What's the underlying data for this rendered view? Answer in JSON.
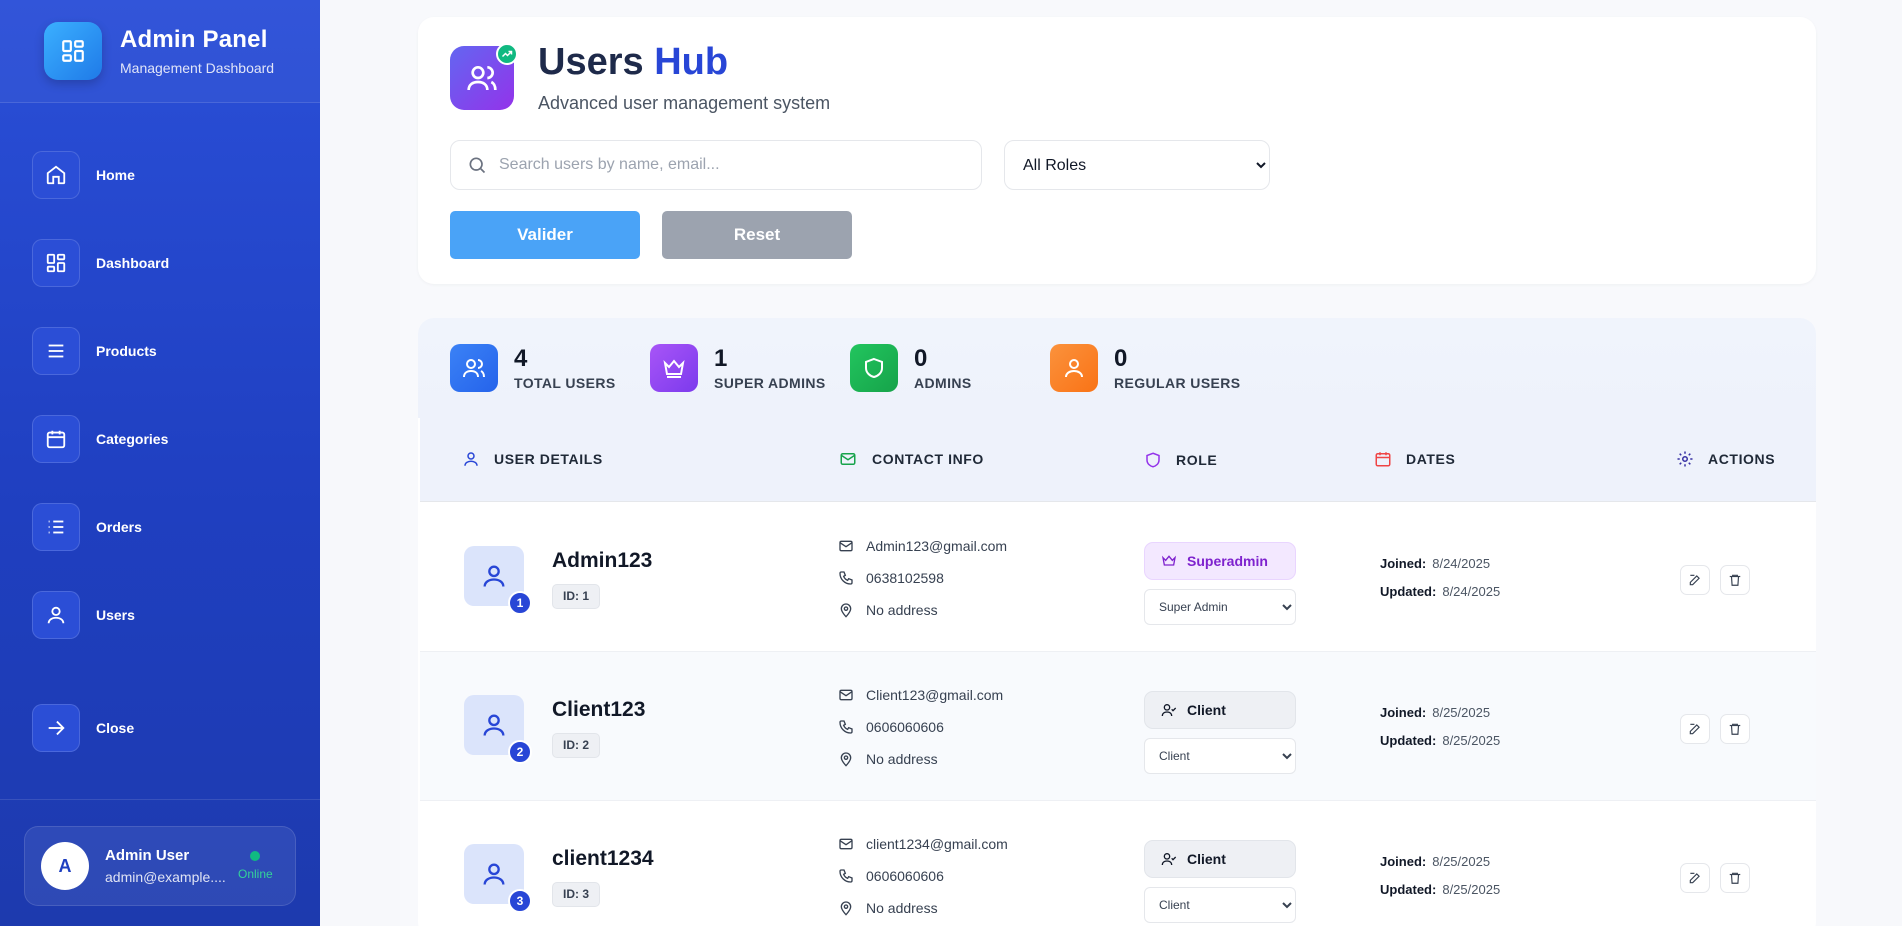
{
  "sidebar": {
    "brand_title": "Admin Panel",
    "brand_subtitle": "Management Dashboard",
    "items": [
      {
        "label": "Home",
        "icon": "home-icon"
      },
      {
        "label": "Dashboard",
        "icon": "grid-icon"
      },
      {
        "label": "Products",
        "icon": "list-icon"
      },
      {
        "label": "Categories",
        "icon": "calendar-icon"
      },
      {
        "label": "Orders",
        "icon": "ordered-list-icon"
      },
      {
        "label": "Users",
        "icon": "user-icon"
      }
    ],
    "close_label": "Close",
    "user": {
      "initial": "A",
      "name": "Admin User",
      "email": "admin@example....",
      "status": "Online"
    }
  },
  "header": {
    "title_main": "Users",
    "title_accent": "Hub",
    "subtitle": "Advanced user management system",
    "search_placeholder": "Search users by name, email...",
    "role_filter": "All Roles",
    "validate_label": "Valider",
    "reset_label": "Reset"
  },
  "stats": [
    {
      "value": "4",
      "label": "TOTAL USERS",
      "color": "#2563eb"
    },
    {
      "value": "1",
      "label": "SUPER ADMINS",
      "color": "#9333ea"
    },
    {
      "value": "0",
      "label": "ADMINS",
      "color": "#16a34a"
    },
    {
      "value": "0",
      "label": "REGULAR USERS",
      "color": "#f97316"
    }
  ],
  "table": {
    "columns": [
      "USER DETAILS",
      "CONTACT INFO",
      "ROLE",
      "DATES",
      "ACTIONS"
    ],
    "joined_label": "Joined:",
    "updated_label": "Updated:",
    "rows": [
      {
        "num": "1",
        "name": "Admin123",
        "id": "ID: 1",
        "email": "Admin123@gmail.com",
        "phone": "0638102598",
        "address": "No address",
        "role_badge": "Superadmin",
        "role_select": "Super Admin",
        "joined": "8/24/2025",
        "updated": "8/24/2025"
      },
      {
        "num": "2",
        "name": "Client123",
        "id": "ID: 2",
        "email": "Client123@gmail.com",
        "phone": "0606060606",
        "address": "No address",
        "role_badge": "Client",
        "role_select": "Client",
        "joined": "8/25/2025",
        "updated": "8/25/2025"
      },
      {
        "num": "3",
        "name": "client1234",
        "id": "ID: 3",
        "email": "client1234@gmail.com",
        "phone": "0606060606",
        "address": "No address",
        "role_badge": "Client",
        "role_select": "Client",
        "joined": "8/25/2025",
        "updated": "8/25/2025"
      }
    ]
  }
}
